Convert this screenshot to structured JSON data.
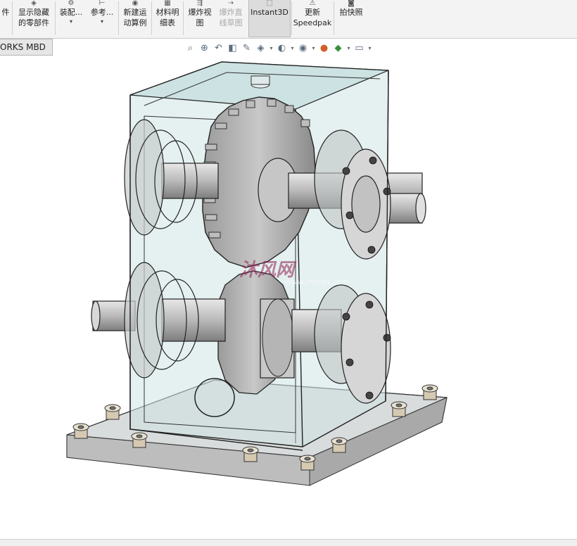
{
  "ribbon": {
    "items": [
      {
        "label": "件",
        "label2": "",
        "icon": "component-icon"
      },
      {
        "label": "显示隐藏",
        "label2": "的零部件",
        "icon": "show-hide-icon"
      },
      {
        "label": "装配...",
        "label2": "",
        "icon": "assembly-icon"
      },
      {
        "label": "参考...",
        "label2": "",
        "icon": "reference-icon"
      },
      {
        "label": "新建运",
        "label2": "动算例",
        "icon": "motion-study-icon"
      },
      {
        "label": "材料明",
        "label2": "细表",
        "icon": "bom-icon"
      },
      {
        "label": "爆炸视",
        "label2": "图",
        "icon": "exploded-view-icon"
      },
      {
        "label": "爆炸直",
        "label2": "线草图",
        "icon": "explode-line-icon"
      },
      {
        "label": "Instant3D",
        "label2": "",
        "icon": "instant3d-icon"
      },
      {
        "label": "更新",
        "label2": "Speedpak",
        "icon": "speedpak-icon"
      },
      {
        "label": "拍快照",
        "label2": "",
        "icon": "snapshot-icon"
      }
    ]
  },
  "tab": {
    "label": "ORKS MBD"
  },
  "heads_up_toolbar": {
    "icons": [
      "zoom-to-fit-icon",
      "zoom-area-icon",
      "previous-view-icon",
      "section-view-icon",
      "dynamic-annotation-icon",
      "view-orientation-icon",
      "display-style-icon",
      "hide-show-items-icon",
      "edit-appearance-icon",
      "apply-scene-icon",
      "view-settings-icon"
    ]
  },
  "viewport": {
    "content": "gearbox-assembly-model"
  },
  "watermark": {
    "title": "沐风网",
    "url": "www.mfcad.com"
  }
}
